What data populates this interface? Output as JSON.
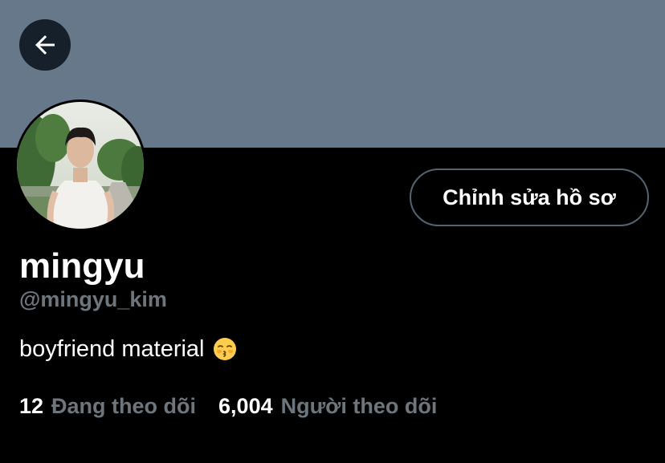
{
  "header": {
    "back_icon": "arrow-left-icon",
    "banner_color": "#66788a"
  },
  "profile": {
    "display_name": "mingyu",
    "handle": "@mingyu_kim",
    "bio": "boyfriend material",
    "bio_emoji": "kissing-face-with-closed-eyes-emoji",
    "edit_button_label": "Chỉnh sửa hồ sơ"
  },
  "stats": {
    "following_count": "12",
    "following_label": "Đang theo dõi",
    "followers_count": "6,004",
    "followers_label": "Người theo dõi"
  },
  "colors": {
    "background": "#000000",
    "text_primary": "#ffffff",
    "text_secondary": "#6e767d",
    "button_border": "#536471"
  }
}
